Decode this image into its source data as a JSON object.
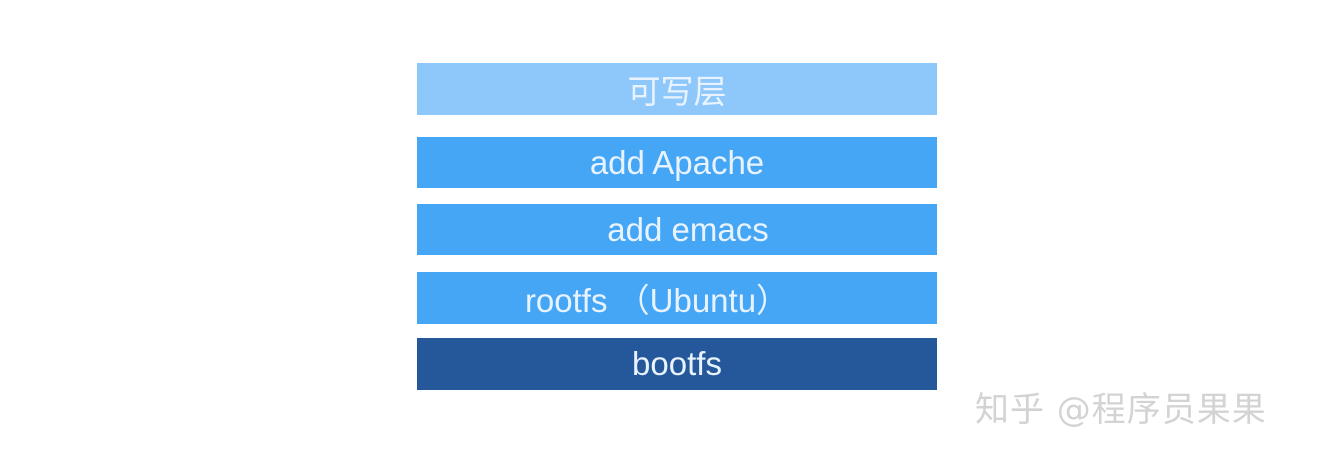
{
  "layers": [
    {
      "label": "可写层",
      "color": "#8ec8fb"
    },
    {
      "label": "add Apache",
      "color": "#45a6f5"
    },
    {
      "label": "add emacs",
      "color": "#45a6f5"
    },
    {
      "label": "rootfs （Ubuntu）",
      "color": "#45a6f5"
    },
    {
      "label": "bootfs",
      "color": "#25589a"
    }
  ],
  "watermark": "知乎 @程序员果果"
}
